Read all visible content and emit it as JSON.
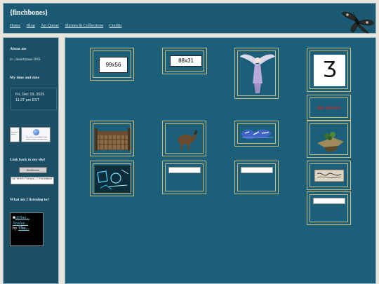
{
  "header": {
    "site_title": "{finchbones}",
    "nav": [
      "Home",
      "Blog",
      "Art Queue",
      "Shrines & Collections",
      "Credits"
    ]
  },
  "sidebar": {
    "about_heading": "About me",
    "about_text": "it+, desert/plane DNS",
    "time_heading": "My time and date",
    "date": "Fri, Dec 19, 2025",
    "time": "11:37 pm EST",
    "badge1_caption": "Big tables queens",
    "badge2_caption": "This website was handmade before artificial websites was appreciated",
    "link_heading": "Link back to my site!",
    "button_label": "finchbones",
    "code_snippet": "<a href=\"https://finchbon",
    "music_heading": "What am I listening to?",
    "music_line1": "@fine...",
    "music_line2": "Noslee...",
    "music_by": "by",
    "music_artist": "The..."
  },
  "main": {
    "label_99x56": "99x56",
    "label_88x31": "88x31",
    "glyph": "Ʒ",
    "red_text": "the mirror"
  },
  "colors": {
    "panel": "#1c5f7a",
    "frame_gold": "#c9bd78",
    "page_bg": "#e7e4dc"
  }
}
